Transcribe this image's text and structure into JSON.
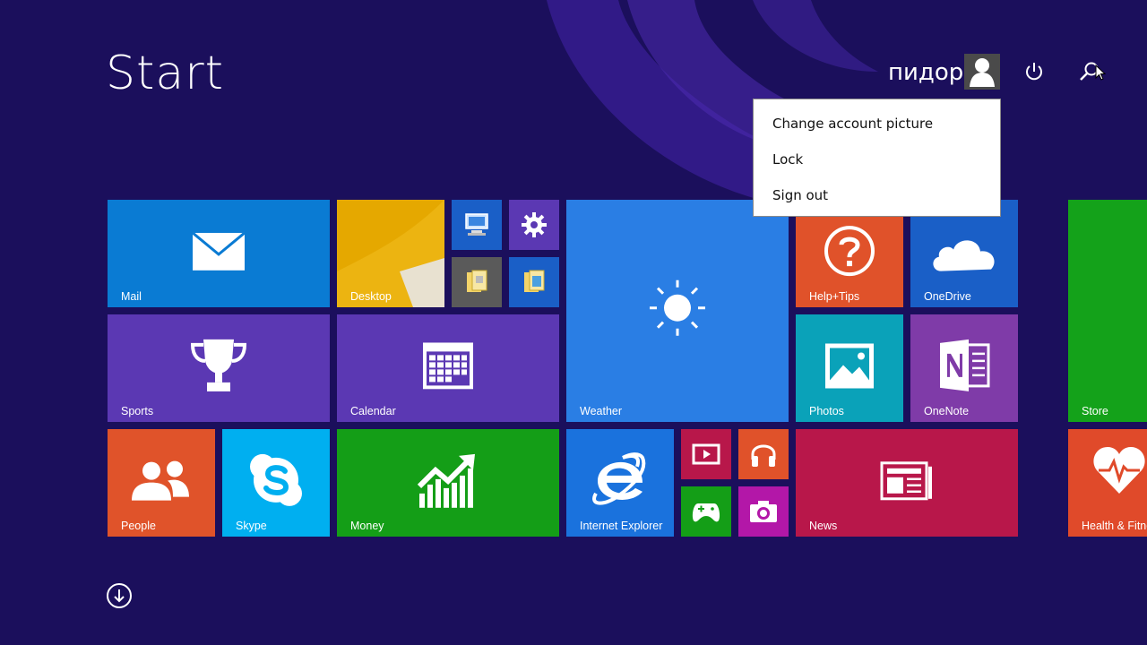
{
  "header": {
    "title": "Start",
    "user_name": "пидор"
  },
  "account_menu": {
    "items": [
      "Change account picture",
      "Lock",
      "Sign out"
    ]
  },
  "tiles": {
    "mail": "Mail",
    "desktop": "Desktop",
    "help_tips": "Help+Tips",
    "onedrive": "OneDrive",
    "sports": "Sports",
    "calendar": "Calendar",
    "weather": "Weather",
    "photos": "Photos",
    "onenote": "OneNote",
    "store": "Store",
    "people": "People",
    "skype": "Skype",
    "money": "Money",
    "internet_explorer": "Internet Explorer",
    "news": "News",
    "health_fitness": "Health & Fitness"
  },
  "colors": {
    "background": "#1b0f5c",
    "mail": "#0a7bd3",
    "desktop": "#e5a800",
    "sports": "#5b38b3",
    "calendar": "#5b38b3",
    "weather": "#2a7ee4",
    "help_tips": "#e0522a",
    "onedrive": "#1a5fc7",
    "photos": "#0aa2b9",
    "onenote": "#7f3ba8",
    "store": "#14a21a",
    "people": "#e0532a",
    "skype": "#00aff0",
    "money": "#149e17",
    "internet_explorer": "#1a72dd",
    "news": "#b8174a",
    "health": "#e04a2a"
  }
}
